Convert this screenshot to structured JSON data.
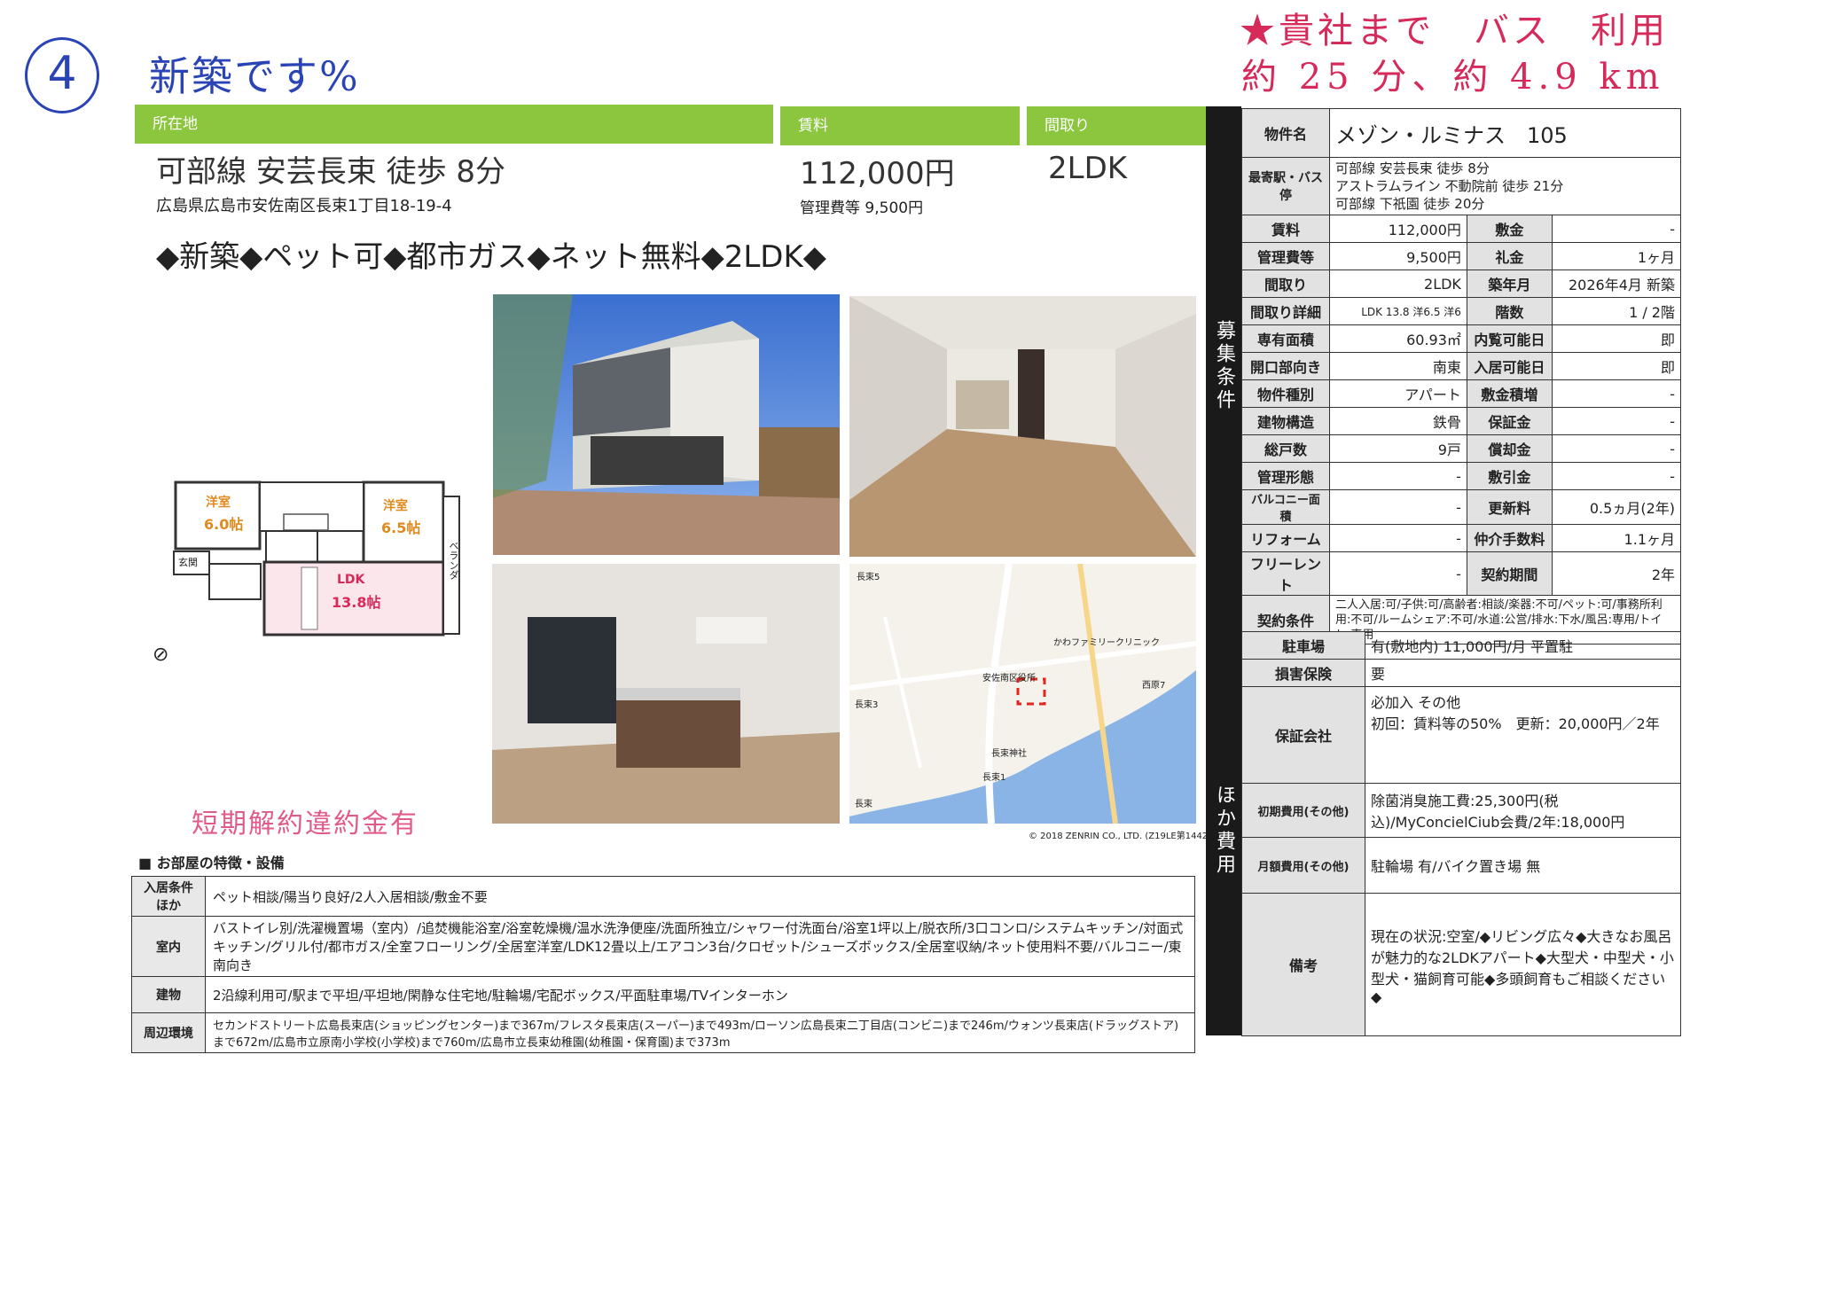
{
  "handwritten": {
    "circle_number": "4",
    "note_left": "新築です%",
    "note_right_line1": "★貴社まで　バス　利用",
    "note_right_line2": "約 25 分、約 4.9 km"
  },
  "headers": {
    "location": "所在地",
    "rent": "賃料",
    "layout": "間取り"
  },
  "location": {
    "line": "可部線 安芸長束 徒歩 8分",
    "address": "広島県広島市安佐南区長束1丁目18-19-4"
  },
  "rent": {
    "amount": "112,000円",
    "mgmt": "管理費等 9,500円"
  },
  "layout_type": "2LDK",
  "highlight": "◆新築◆ペット可◆都市ガス◆ネット無料◆2LDK◆",
  "floorplan": {
    "room1": "洋室",
    "room1_size": "6.0帖",
    "room2": "洋室",
    "room2_size": "6.5帖",
    "ldk": "LDK",
    "ldk_size": "13.8帖",
    "veranda": "ベランダ",
    "entrance": "玄関"
  },
  "penalty_note": "短期解約違約金有",
  "map_copyright": "© 2018 ZENRIN CO., LTD. (Z19LE第1442号)",
  "map_labels": [
    "長束5",
    "長束3",
    "長束1",
    "長束",
    "西原7",
    "長束神社",
    "かわファミリークリニック",
    "安佐南区役所"
  ],
  "features": {
    "title": "■ お部屋の特徴・設備",
    "rows": [
      {
        "head": "入居条件ほか",
        "text": "ペット相談/陽当り良好/2人入居相談/敷金不要"
      },
      {
        "head": "室内",
        "text": "バストイレ別/洗濯機置場（室内）/追焚機能浴室/浴室乾燥機/温水洗浄便座/洗面所独立/シャワー付洗面台/浴室1坪以上/脱衣所/3口コンロ/システムキッチン/対面式キッチン/グリル付/都市ガス/全室フローリング/全居室洋室/LDK12畳以上/エアコン3台/クロゼット/シューズボックス/全居室収納/ネット使用料不要/バルコニー/東南向き"
      },
      {
        "head": "建物",
        "text": "2沿線利用可/駅まで平坦/平坦地/閑静な住宅地/駐輪場/宅配ボックス/平面駐車場/TVインターホン"
      },
      {
        "head": "周辺環境",
        "text": "セカンドストリート広島長束店(ショッピングセンター)まで367m/フレスタ長束店(スーパー)まで493m/ローソン広島長束二丁目店(コンビニ)まで246m/ウォンツ長束店(ドラッグストア)まで672m/広島市立原南小学校(小学校)まで760m/広島市立長束幼稚園(幼稚園・保育園)まで373m"
      }
    ]
  },
  "sidebar1": "募集条件",
  "sidebar2": "ほか費用",
  "property": {
    "name_label": "物件名",
    "name": "メゾン・ルミナス　105",
    "station_label": "最寄駅・バス停",
    "stations": [
      "可部線 安芸長束 徒歩 8分",
      "アストラムライン 不動院前 徒歩 21分",
      "可部線 下祇園 徒歩 20分"
    ]
  },
  "conditions": [
    {
      "l1": "賃料",
      "v1": "112,000円",
      "l2": "敷金",
      "v2": "-"
    },
    {
      "l1": "管理費等",
      "v1": "9,500円",
      "l2": "礼金",
      "v2": "1ヶ月"
    },
    {
      "l1": "間取り",
      "v1": "2LDK",
      "l2": "築年月",
      "v2": "2026年4月 新築"
    },
    {
      "l1": "間取り詳細",
      "v1": "LDK 13.8 洋6.5 洋6",
      "l2": "階数",
      "v2": "1 / 2階"
    },
    {
      "l1": "専有面積",
      "v1": "60.93㎡",
      "l2": "内覧可能日",
      "v2": "即"
    },
    {
      "l1": "開口部向き",
      "v1": "南東",
      "l2": "入居可能日",
      "v2": "即"
    },
    {
      "l1": "物件種別",
      "v1": "アパート",
      "l2": "敷金積増",
      "v2": "-"
    },
    {
      "l1": "建物構造",
      "v1": "鉄骨",
      "l2": "保証金",
      "v2": "-"
    },
    {
      "l1": "総戸数",
      "v1": "9戸",
      "l2": "償却金",
      "v2": "-"
    },
    {
      "l1": "管理形態",
      "v1": "-",
      "l2": "敷引金",
      "v2": "-"
    },
    {
      "l1": "バルコニー面積",
      "v1": "-",
      "l2": "更新料",
      "v2": "0.5ヵ月(2年)"
    },
    {
      "l1": "リフォーム",
      "v1": "-",
      "l2": "仲介手数料",
      "v2": "1.1ヶ月"
    },
    {
      "l1": "フリーレント",
      "v1": "-",
      "l2": "契約期間",
      "v2": "2年"
    }
  ],
  "contract": {
    "label": "契約条件",
    "text": "二人入居:可/子供:可/高齢者:相談/楽器:不可/ペット:可/事務所利用:不可/ルームシェア:不可/水道:公営/排水:下水/風呂:専用/トイレ:専用"
  },
  "costs": [
    {
      "label": "駐車場",
      "text": "有(敷地内) 11,000円/月 平置駐"
    },
    {
      "label": "損害保険",
      "text": "要"
    },
    {
      "label": "保証会社",
      "text": "必加入 その他\n初回：賃料等の50%　更新：20,000円／2年"
    },
    {
      "label": "初期費用(その他)",
      "text": "除菌消臭施工費:25,300円(税込)/MyConcielCiub会費/2年:18,000円"
    },
    {
      "label": "月額費用(その他)",
      "text": "駐輪場 有/バイク置き場 無"
    },
    {
      "label": "備考",
      "text": "現在の状況:空室/◆リビング広々◆大きなお風呂が魅力的な2LDKアパート◆大型犬・中型犬・小型犬・猫飼育可能◆多頭飼育もご相談ください◆"
    }
  ]
}
